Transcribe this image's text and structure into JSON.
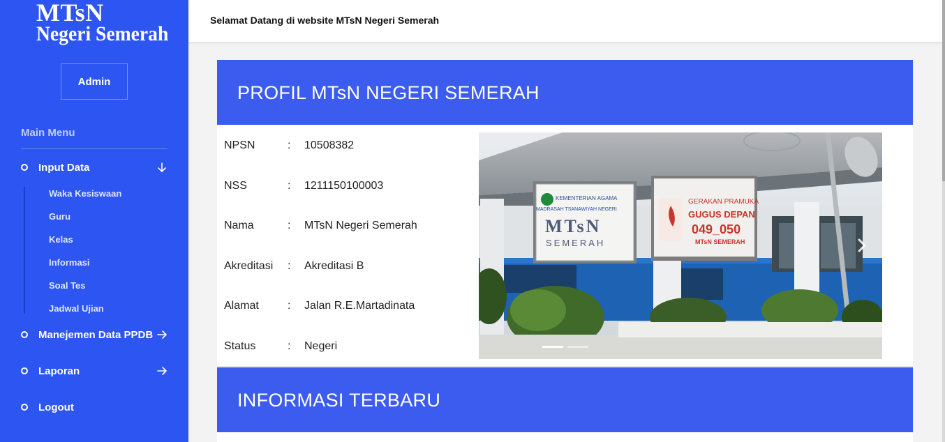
{
  "sidebar": {
    "logo_line1": "MTsN",
    "logo_line2": "Negeri Semerah",
    "admin_label": "Admin",
    "main_menu_label": "Main Menu",
    "menu": {
      "input_data": "Input Data",
      "manajemen_ppdb": "Manejemen Data PPDB",
      "laporan": "Laporan",
      "logout": "Logout"
    },
    "submenu": [
      "Waka Kesiswaan",
      "Guru",
      "Kelas",
      "Informasi",
      "Soal Tes",
      "Jadwal Ujian"
    ]
  },
  "topbar": {
    "welcome": "Selamat Datang di website MTsN Negeri Semerah"
  },
  "profile": {
    "title": "PROFIL MTsN NEGERI SEMERAH",
    "rows": [
      {
        "key": "NPSN",
        "sep": ":",
        "value": "10508382"
      },
      {
        "key": "NSS",
        "sep": ":",
        "value": "1211150100003"
      },
      {
        "key": "Nama",
        "sep": ":",
        "value": "MTsN Negeri Semerah"
      },
      {
        "key": "Akreditasi",
        "sep": ":",
        "value": "Akreditasi B"
      },
      {
        "key": "Alamat",
        "sep": ":",
        "value": "Jalan R.E.Martadinata"
      },
      {
        "key": "Status",
        "sep": ":",
        "value": "Negeri"
      }
    ]
  },
  "carousel": {
    "sign1": {
      "line1": "KEMENTERIAN AGAMA",
      "line2": "MADRASAH TSANAWIYAH NEGERI",
      "line3": "MTsN",
      "line4": "SEMERAH"
    },
    "sign2": {
      "line1": "GERAKAN PRAMUKA",
      "line2": "GUGUS DEPAN",
      "line3": "049_050",
      "line4": "MTsN SEMERAH"
    },
    "active_slide": 1,
    "slide_count": 2
  },
  "informasi": {
    "title": "INFORMASI TERBARU"
  },
  "colors": {
    "sidebar": "#2d55f2",
    "header": "#3c5cf0",
    "background": "#f3f3f3"
  }
}
